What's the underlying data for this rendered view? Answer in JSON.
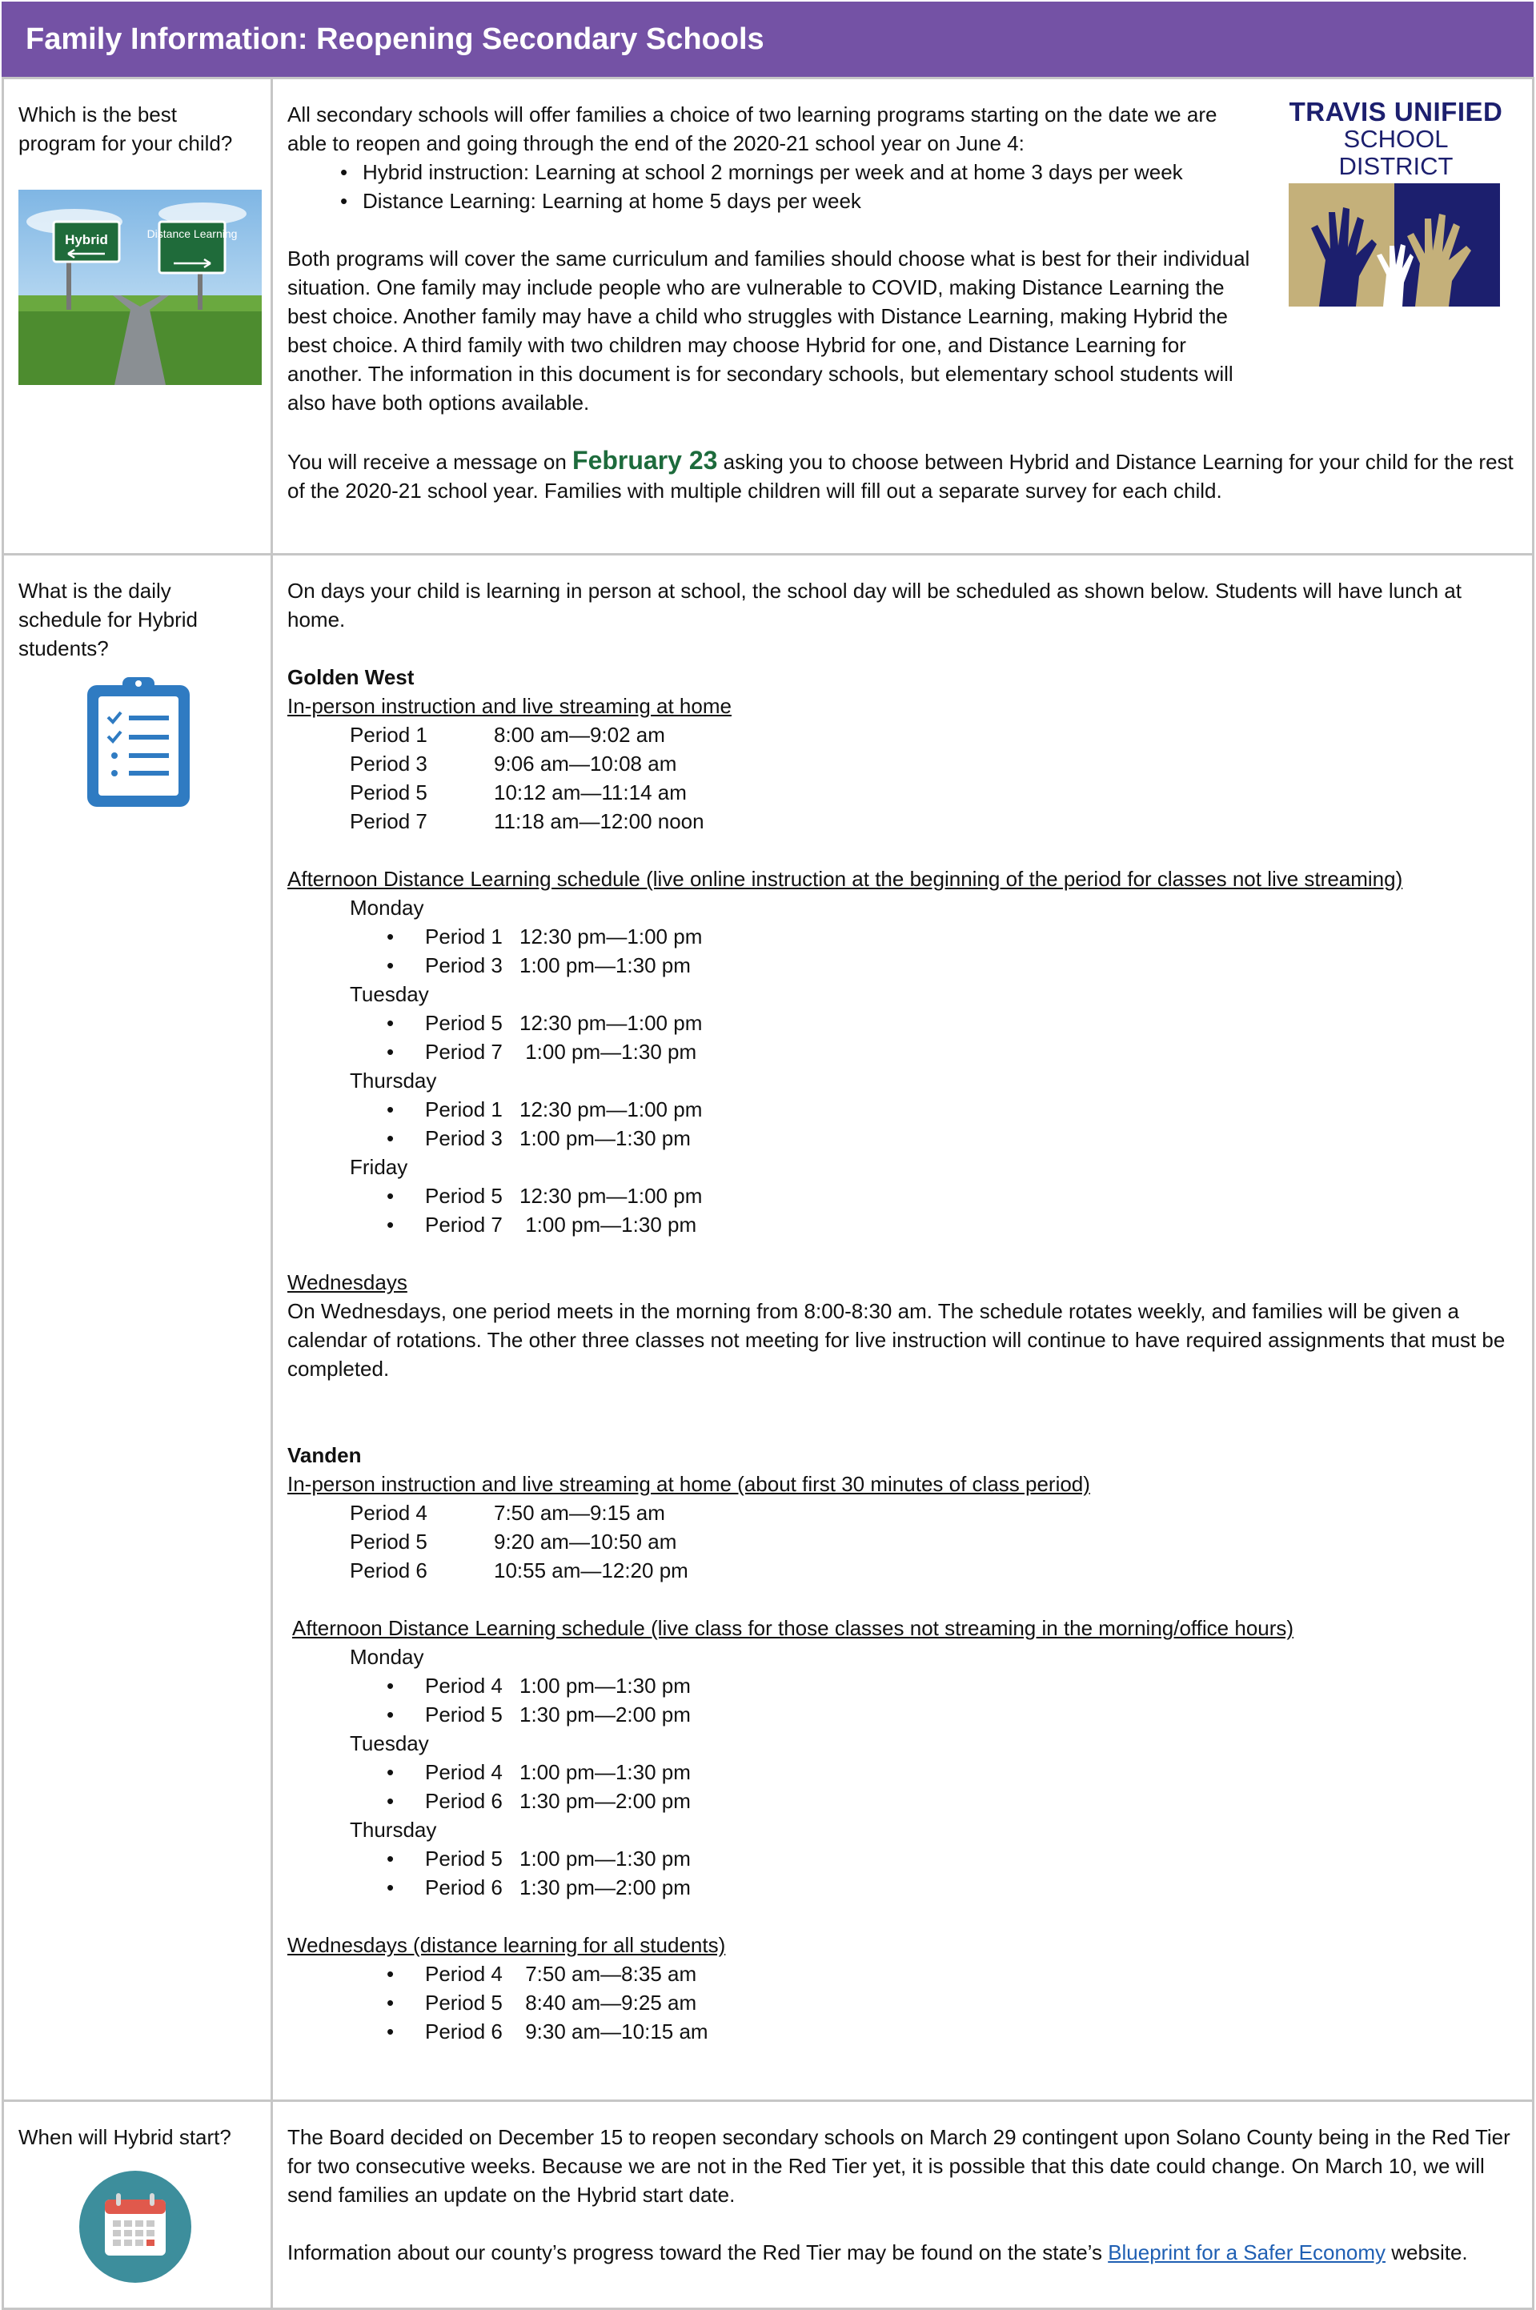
{
  "banner": {
    "title": "Family Information:  Reopening Secondary Schools"
  },
  "section1": {
    "question": "Which is the best program for your child?",
    "sign_left": "Hybrid",
    "sign_right": "Distance Learning",
    "logo_line1": "TRAVIS UNIFIED",
    "logo_line2": "SCHOOL DISTRICT",
    "intro": "All secondary schools will offer families a choice of two learning programs starting on the date we are able to reopen and going through the end of the 2020-21 school year on June 4:",
    "options": [
      "Hybrid instruction:  Learning at school 2 mornings per week and at home 3 days per week",
      "Distance Learning:  Learning at home 5 days per week"
    ],
    "curriculum": "Both programs will cover the same curriculum and families should choose what is best for their individual situation.  One family may include people who are vulnerable to COVID, making Distance Learning the best choice.  Another family may have a child who struggles with Distance Learning, making Hybrid the best choice.  A third family with two children may choose Hybrid for one, and Distance Learning for another.  The information in this document is for secondary schools, but elementary school students will also have both options available.",
    "message_pre": "You will receive a message on ",
    "message_date": "February 23",
    "message_post": " asking you to choose between Hybrid and Distance Learning for your child for the rest of the 2020-21 school year.   Families with multiple children will fill out a separate survey for each child."
  },
  "section2": {
    "question": "What is the daily schedule for Hybrid students?",
    "intro": "On days your child is learning in person at school, the school day will be scheduled as shown below.  Students will have lunch at home.",
    "golden_west": {
      "name": "Golden West",
      "inperson_heading": "In-person instruction and live streaming at home",
      "periods": [
        {
          "period": "Period 1",
          "time": "8:00 am—9:02 am"
        },
        {
          "period": "Period 3",
          "time": "9:06 am—10:08 am"
        },
        {
          "period": "Period 5",
          "time": "10:12 am—11:14 am"
        },
        {
          "period": "Period 7",
          "time": "11:18 am—12:00 noon"
        }
      ],
      "afternoon_heading": "Afternoon Distance Learning schedule (live online instruction at the beginning of the period for classes not live streaming)",
      "days": [
        {
          "day": "Monday",
          "items": [
            {
              "period": "Period 1",
              "time": "12:30 pm—1:00 pm"
            },
            {
              "period": "Period 3",
              "time": "1:00 pm—1:30 pm"
            }
          ]
        },
        {
          "day": "Tuesday",
          "items": [
            {
              "period": "Period 5",
              "time": "12:30 pm—1:00 pm"
            },
            {
              "period": "Period 7",
              "time": " 1:00 pm—1:30 pm"
            }
          ]
        },
        {
          "day": "Thursday",
          "items": [
            {
              "period": "Period 1",
              "time": "12:30 pm—1:00 pm"
            },
            {
              "period": "Period 3",
              "time": "1:00 pm—1:30 pm"
            }
          ]
        },
        {
          "day": "Friday",
          "items": [
            {
              "period": "Period 5",
              "time": "12:30 pm—1:00 pm"
            },
            {
              "period": "Period 7",
              "time": " 1:00 pm—1:30 pm"
            }
          ]
        }
      ],
      "wednesday_heading": "Wednesdays",
      "wednesday_text": "On Wednesdays, one period meets in the morning from 8:00-8:30 am. The schedule rotates weekly, and families will be given a calendar of rotations. The other three classes not meeting for live instruction will continue to have required assignments that must be completed."
    },
    "vanden": {
      "name": "Vanden",
      "inperson_heading": "In-person instruction and live streaming at home (about first 30 minutes of class period)",
      "periods": [
        {
          "period": "Period 4",
          "time": "7:50 am—9:15 am"
        },
        {
          "period": "Period 5",
          "time": "9:20 am—10:50 am"
        },
        {
          "period": "Period 6",
          "time": "10:55 am—12:20 pm"
        }
      ],
      "afternoon_heading": "Afternoon Distance Learning schedule (live class for those classes not streaming in the morning/office hours)",
      "days": [
        {
          "day": "Monday",
          "items": [
            {
              "period": "Period 4",
              "time": "1:00 pm—1:30 pm"
            },
            {
              "period": "Period 5",
              "time": "1:30 pm—2:00 pm"
            }
          ]
        },
        {
          "day": "Tuesday",
          "items": [
            {
              "period": "Period 4",
              "time": "1:00 pm—1:30 pm"
            },
            {
              "period": "Period 6",
              "time": "1:30 pm—2:00 pm"
            }
          ]
        },
        {
          "day": "Thursday",
          "items": [
            {
              "period": "Period 5",
              "time": "1:00 pm—1:30 pm"
            },
            {
              "period": "Period 6",
              "time": "1:30 pm—2:00 pm"
            }
          ]
        }
      ],
      "wednesday_heading": "Wednesdays (distance learning for all students)",
      "wednesday_items": [
        {
          "period": "Period 4",
          "time": " 7:50 am—8:35 am"
        },
        {
          "period": "Period 5",
          "time": " 8:40 am—9:25 am"
        },
        {
          "period": "Period 6",
          "time": " 9:30 am—10:15 am"
        }
      ]
    }
  },
  "section3": {
    "question": "When will Hybrid start?",
    "text": "The Board decided on December 15 to reopen secondary schools on March 29 contingent upon Solano County being in the Red Tier for two consecutive weeks.  Because we are not in the Red Tier yet, it is possible that this date could change.  On March 10, we will send families an update on the Hybrid start date.",
    "info_pre": "Information about our county’s progress toward the Red Tier may be found on the state’s ",
    "info_link": "Blueprint for a Safer Economy",
    "info_post": " website."
  },
  "colors": {
    "banner": "#7452a5",
    "logo_navy": "#1c1f6e",
    "logo_tan": "#c4b07a",
    "link": "#1f5fb3",
    "date": "#1d6b3c"
  }
}
